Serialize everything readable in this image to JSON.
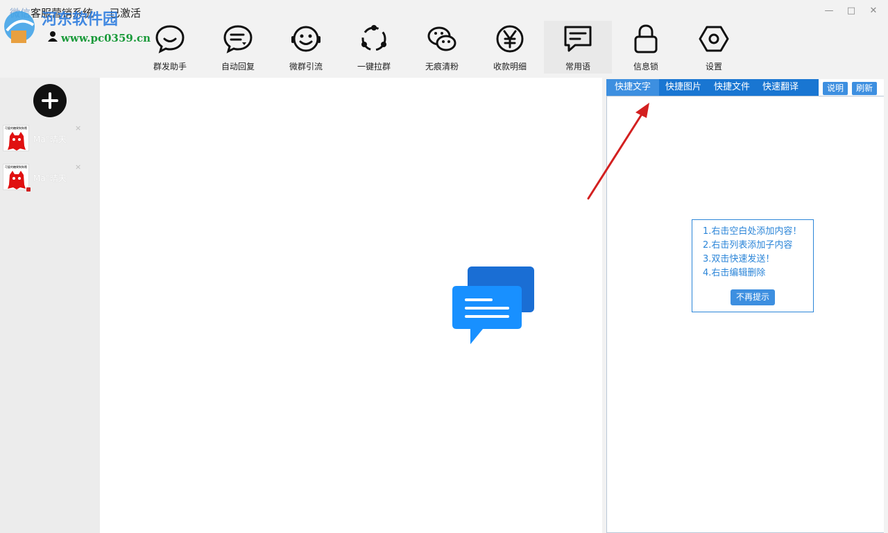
{
  "window": {
    "title_prefix": "微信",
    "title": "客服营销系统",
    "status": "已激活",
    "controls": {
      "minimize": "—",
      "maximize": "□",
      "close": "✕"
    }
  },
  "watermark": {
    "text": "河东软件园",
    "url": "www.pc0359.cn"
  },
  "toolbar": [
    {
      "label": "群发助手",
      "icon": "chat-bubble-icon"
    },
    {
      "label": "自动回复",
      "icon": "auto-reply-icon"
    },
    {
      "label": "微群引流",
      "icon": "smiley-icon"
    },
    {
      "label": "一键拉群",
      "icon": "group-circle-icon"
    },
    {
      "label": "无痕清粉",
      "icon": "wechat-icon"
    },
    {
      "label": "收款明细",
      "icon": "yen-icon"
    },
    {
      "label": "常用语",
      "icon": "message-text-icon",
      "active": true
    },
    {
      "label": "信息锁",
      "icon": "lock-icon"
    },
    {
      "label": "设置",
      "icon": "gear-icon"
    }
  ],
  "sidebar": {
    "accounts": [
      {
        "name": "Ma°晴天",
        "avatar_caption": "可爱的糖果狗狗哦",
        "online": false
      },
      {
        "name": "Ma°晴天",
        "avatar_caption": "可爱的糖果狗狗哦",
        "online": true
      }
    ],
    "close_glyph": "×"
  },
  "right_panel": {
    "tabs": [
      "快捷文字",
      "快捷图片",
      "快捷文件",
      "快速翻译"
    ],
    "active_tab": "快捷文字",
    "buttons": {
      "help": "说明",
      "refresh": "刷新"
    },
    "tips": {
      "lines": [
        "1.右击空白处添加内容！",
        "2.右击列表添加子内容",
        "3.双击快速发送！",
        "4.右击编辑删除"
      ],
      "dismiss_label": "不再提示"
    }
  },
  "colors": {
    "accent": "#1976d2",
    "accent_light": "#3d8fe0",
    "tips_text": "#2b85d8",
    "arrow": "#d32020",
    "chat_back": "#1a6ed4",
    "chat_front": "#1890ff"
  }
}
